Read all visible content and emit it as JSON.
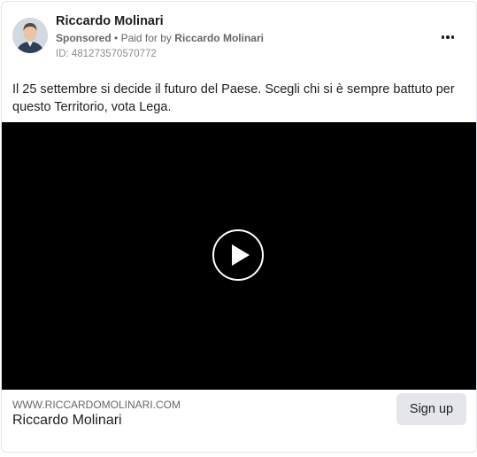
{
  "ad": {
    "advertiser": "Riccardo Molinari",
    "sponsored": "Sponsored",
    "paid_for_by": "Paid for by",
    "paid_name": "Riccardo Molinari",
    "separator": "•",
    "ad_id": "ID: 481273570570772",
    "body_text": "Il 25 settembre si decide il futuro del Paese. Scegli chi si è sempre battuto per questo Territorio, vota Lega.",
    "more_icon": "more-options-icon",
    "video": {
      "background": "#000000",
      "play_icon": "play-icon"
    },
    "link": {
      "url": "WWW.RICCARDOMOLINARI.COM",
      "title": "Riccardo Molinari",
      "cta_label": "Sign up"
    }
  },
  "colors": {
    "text_primary": "#1c1e21",
    "text_secondary": "#65676b",
    "button_bg": "#e4e6eb",
    "border": "#e4e6eb"
  }
}
